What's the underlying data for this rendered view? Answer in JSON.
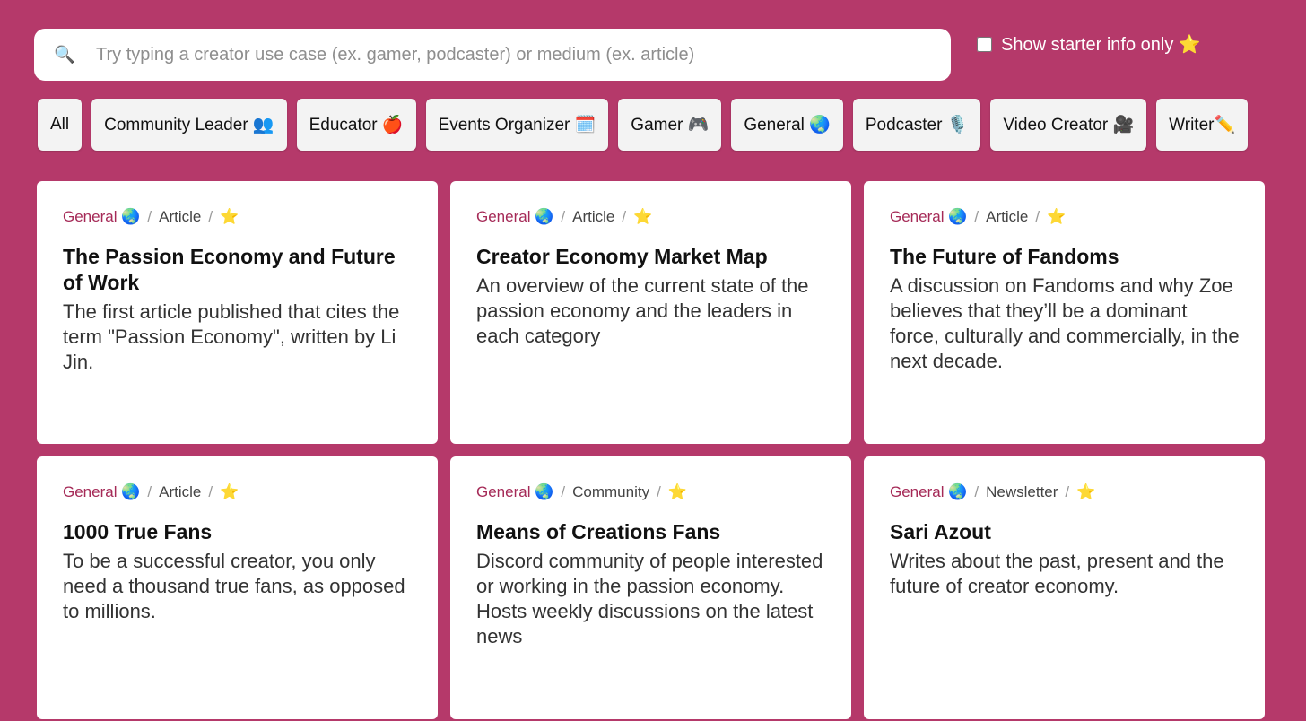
{
  "search": {
    "icon": "search-icon",
    "placeholder": "Try typing a creator use case (ex. gamer, podcaster) or medium (ex. article)"
  },
  "starter_toggle": {
    "label": "Show starter info only ⭐",
    "checked": false
  },
  "filters": [
    "All",
    "Community Leader 👥",
    "Educator 🍎",
    "Events Organizer 🗓️",
    "Gamer 🎮",
    "General 🌏",
    "Podcaster 🎙️",
    "Video Creator 🎥",
    "Writer✏️"
  ],
  "cards": [
    {
      "category": "General 🌏",
      "medium": "Article",
      "star": "⭐",
      "title": "The Passion Economy and Future of Work",
      "description": "The first article published that cites the term \"Passion Economy\", written by Li Jin."
    },
    {
      "category": "General 🌏",
      "medium": "Article",
      "star": "⭐",
      "title": "Creator Economy Market Map",
      "description": "An overview of the current state of the passion economy and the leaders in each category"
    },
    {
      "category": "General 🌏",
      "medium": "Article",
      "star": "⭐",
      "title": "The Future of Fandoms",
      "description": "A discussion on Fandoms and why Zoe believes that they’ll be a dominant force, culturally and commercially, in the next decade."
    },
    {
      "category": "General 🌏",
      "medium": "Article",
      "star": "⭐",
      "title": "1000 True Fans",
      "description": "To be a successful creator, you only need a thousand true fans, as opposed to millions."
    },
    {
      "category": "General 🌏",
      "medium": "Community",
      "star": "⭐",
      "title": "Means of Creations Fans",
      "description": "Discord community of people interested or working in the passion economy. Hosts weekly discussions on the latest news"
    },
    {
      "category": "General 🌏",
      "medium": "Newsletter",
      "star": "⭐",
      "title": "Sari Azout",
      "description": "Writes about the past, present and the future of creator economy."
    }
  ],
  "colors": {
    "background": "#b5396a",
    "category_accent": "#a52a57"
  }
}
